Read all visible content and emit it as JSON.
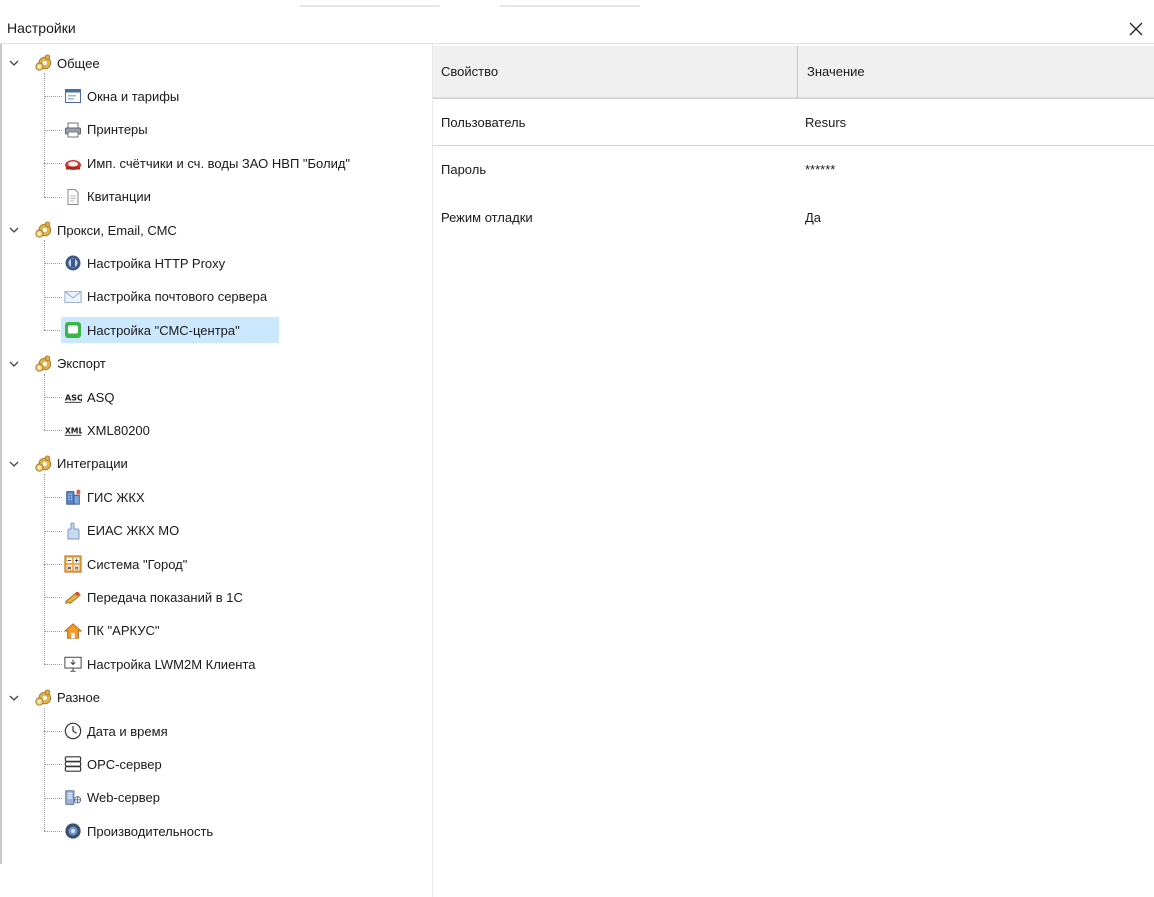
{
  "window": {
    "title": "Настройки",
    "close_icon": "close-icon"
  },
  "tree": {
    "groups": [
      {
        "label": "Общее",
        "icon": "gears-icon",
        "children": [
          {
            "label": "Окна и тарифы",
            "icon": "window-icon"
          },
          {
            "label": "Принтеры",
            "icon": "printer-icon"
          },
          {
            "label": "Имп. счётчики и сч. воды ЗАО НВП \"Болид\"",
            "icon": "counter-icon"
          },
          {
            "label": "Квитанции",
            "icon": "receipt-icon"
          }
        ]
      },
      {
        "label": "Прокси, Email, СМС",
        "icon": "gears-icon",
        "children": [
          {
            "label": "Настройка HTTP Proxy",
            "icon": "proxy-icon"
          },
          {
            "label": "Настройка почтового сервера",
            "icon": "mail-icon"
          },
          {
            "label": "Настройка \"СМС-центра\"",
            "icon": "sms-icon",
            "selected": true
          }
        ]
      },
      {
        "label": "Экспорт",
        "icon": "gears-icon",
        "children": [
          {
            "label": "ASQ",
            "icon": "asq-icon"
          },
          {
            "label": "XML80200",
            "icon": "xml-icon"
          }
        ]
      },
      {
        "label": "Интеграции",
        "icon": "gears-icon",
        "children": [
          {
            "label": "ГИС ЖКХ",
            "icon": "building-icon"
          },
          {
            "label": "ЕИАС ЖКХ МО",
            "icon": "hand-icon"
          },
          {
            "label": "Система \"Город\"",
            "icon": "calculator-icon"
          },
          {
            "label": "Передача показаний в 1С",
            "icon": "transfer-icon"
          },
          {
            "label": "ПК \"АРКУС\"",
            "icon": "house-icon"
          },
          {
            "label": "Настройка LWM2M Клиента",
            "icon": "monitor-icon"
          }
        ]
      },
      {
        "label": "Разное",
        "icon": "gears-icon",
        "children": [
          {
            "label": "Дата и время",
            "icon": "clock-icon"
          },
          {
            "label": "OPC-сервер",
            "icon": "server-icon"
          },
          {
            "label": "Web-сервер",
            "icon": "web-server-icon"
          },
          {
            "label": "Производительность",
            "icon": "performance-icon"
          }
        ]
      }
    ]
  },
  "grid": {
    "headers": {
      "property": "Свойство",
      "value": "Значение"
    },
    "rows": [
      {
        "property": "Пользователь",
        "value": "Resurs"
      },
      {
        "property": "Пароль",
        "value": "******"
      },
      {
        "property": "Режим отладки",
        "value": "Да"
      }
    ]
  }
}
